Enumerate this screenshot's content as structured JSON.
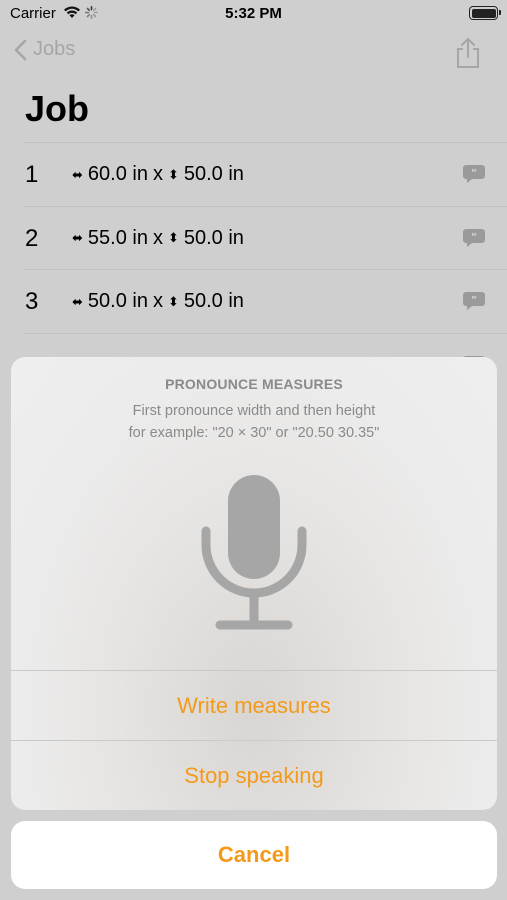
{
  "status_bar": {
    "carrier": "Carrier",
    "time": "5:32 PM"
  },
  "nav": {
    "back_label": "Jobs"
  },
  "page": {
    "title": "Job"
  },
  "jobs": [
    {
      "num": "1",
      "width": "60.0 in",
      "height": "50.0 in"
    },
    {
      "num": "2",
      "width": "55.0 in",
      "height": "50.0 in"
    },
    {
      "num": "3",
      "width": "50.0 in",
      "height": "50.0 in"
    }
  ],
  "dims_separator": "x",
  "sheet": {
    "title": "PRONOUNCE MEASURES",
    "message_line1": "First pronounce width and then height",
    "message_line2": "for example: \"20 × 30\" or \"20.50 30.35\"",
    "actions": [
      "Write measures",
      "Stop speaking"
    ],
    "cancel": "Cancel"
  },
  "colors": {
    "accent": "#f39a1b",
    "dimmed_background": "#cfcfcf",
    "icon_gray": "#a6a6a6"
  }
}
